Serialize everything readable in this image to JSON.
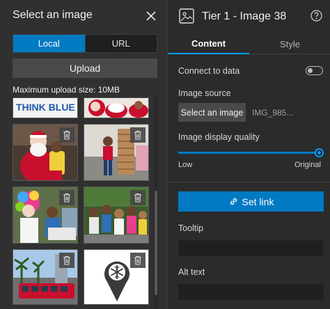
{
  "left_panel": {
    "title": "Select an image",
    "tabs": {
      "local": "Local",
      "url": "URL"
    },
    "upload_label": "Upload",
    "max_upload": "Maximum upload size: 10MB"
  },
  "right_panel": {
    "title": "Tier 1 - Image 38",
    "tabs": {
      "content": "Content",
      "style": "Style"
    },
    "connect_to_data": "Connect to data",
    "connect_to_data_on": false,
    "image_source_label": "Image source",
    "select_image_button": "Select an image",
    "file_name": "IMG_985...",
    "display_quality_label": "Image display quality",
    "quality_low": "Low",
    "quality_high": "Original",
    "quality_value": 1.0,
    "set_link_label": "Set link",
    "tooltip_label": "Tooltip",
    "tooltip_value": "",
    "alt_text_label": "Alt text",
    "alt_text_value": ""
  },
  "thumb_banner_text": "THINK BLUE",
  "colors": {
    "accent": "#007ac2",
    "accent_highlight": "#00a0ff",
    "panel_bg": "#303030",
    "right_bg": "#2b2b2b"
  }
}
